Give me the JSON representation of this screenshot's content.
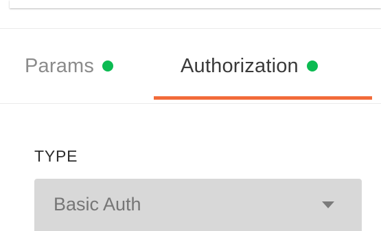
{
  "tabs": [
    {
      "label": "Params",
      "active": false,
      "has_indicator": true
    },
    {
      "label": "Authorization",
      "active": true,
      "has_indicator": true
    }
  ],
  "colors": {
    "accent": "#f26b3a",
    "indicator": "#0cbb52",
    "select_bg": "#d8d8d8"
  },
  "auth": {
    "type_label": "TYPE",
    "selected_type": "Basic Auth"
  },
  "icons": {
    "dropdown": "chevron-down-icon",
    "indicator": "status-dot-icon"
  }
}
